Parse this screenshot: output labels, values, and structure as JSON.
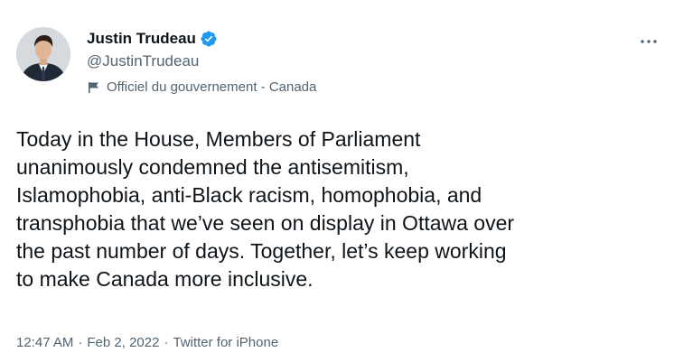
{
  "author": {
    "display_name": "Justin Trudeau",
    "handle": "@JustinTrudeau",
    "verified": true,
    "account_label": "Officiel du gouvernement - Canada"
  },
  "icons": {
    "verified": "verified-badge-icon",
    "label": "flag-icon",
    "more": "more-icon"
  },
  "colors": {
    "verified_blue": "#1d9bf0",
    "secondary_text": "#536471",
    "primary_text": "#0f1419"
  },
  "tweet": {
    "text": "Today in the House, Members of Parliament\nunanimously condemned the antisemitism,\nIslamophobia, anti-Black racism, homophobia, and\ntransphobia that we’ve seen on display in Ottawa over\nthe past number of days. Together, let’s keep working\nto make Canada more inclusive."
  },
  "meta": {
    "time": "12:47 AM",
    "separator": "·",
    "date": "Feb 2, 2022",
    "source": "Twitter for iPhone"
  }
}
